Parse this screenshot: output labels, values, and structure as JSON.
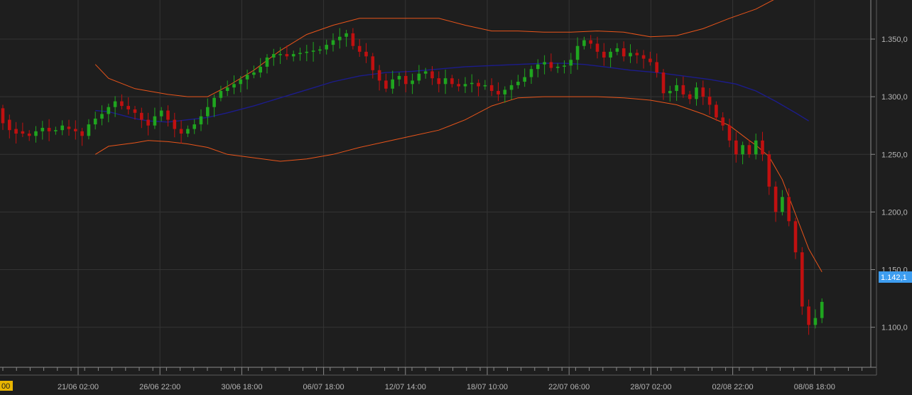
{
  "chart_data": {
    "type": "candlestick",
    "title": "",
    "xlabel": "",
    "ylabel": "",
    "grid": true,
    "y_axis_position": "right",
    "ylim": [
      1060,
      1380
    ],
    "y_ticks": [
      "1.350,0",
      "1.300,0",
      "1.250,0",
      "1.200,0",
      "1.150,0",
      "1.100,0"
    ],
    "y_tick_values": [
      1350,
      1300,
      1250,
      1200,
      1150,
      1100
    ],
    "x_ticks": [
      "21/06 02:00",
      "26/06 22:00",
      "30/06 18:00",
      "06/07 18:00",
      "12/07 14:00",
      "18/07 10:00",
      "22/07 06:00",
      "28/07 02:00",
      "02/08 22:00",
      "08/08 18:00"
    ],
    "x_tick_cut_label": "00",
    "last_price_label": "1.142,1",
    "last_price": 1142.1,
    "colors": {
      "background": "#1e1e1e",
      "grid": "#343434",
      "axis": "#8a8a8a",
      "tick_text": "#b4b4b4",
      "up": "#1fa51f",
      "down": "#c01010",
      "bollinger": "#e8541a",
      "moving_average": "#1c1c8c",
      "price_label_bg": "#3d9df0",
      "price_label_text": "#ffffff",
      "cut_label_bg": "#e9b500"
    },
    "moving_average": [
      [
        14,
        1288
      ],
      [
        16,
        1287
      ],
      [
        18,
        1284
      ],
      [
        20,
        1281
      ],
      [
        22,
        1279
      ],
      [
        25,
        1278
      ],
      [
        28,
        1280
      ],
      [
        31,
        1282
      ],
      [
        34,
        1286
      ],
      [
        38,
        1292
      ],
      [
        42,
        1299
      ],
      [
        46,
        1306
      ],
      [
        50,
        1313
      ],
      [
        54,
        1318
      ],
      [
        58,
        1321
      ],
      [
        62,
        1322
      ],
      [
        66,
        1324
      ],
      [
        70,
        1326
      ],
      [
        74,
        1327
      ],
      [
        78,
        1328
      ],
      [
        82,
        1329
      ],
      [
        85,
        1329
      ],
      [
        88,
        1328
      ],
      [
        91,
        1326
      ],
      [
        95,
        1323
      ],
      [
        99,
        1321
      ],
      [
        103,
        1318
      ],
      [
        107,
        1315
      ],
      [
        111,
        1311
      ],
      [
        114,
        1305
      ],
      [
        117,
        1296
      ],
      [
        120,
        1286
      ],
      [
        122,
        1279
      ]
    ],
    "bollinger_upper": [
      [
        14,
        1328
      ],
      [
        16,
        1316
      ],
      [
        20,
        1307
      ],
      [
        25,
        1302
      ],
      [
        28,
        1300
      ],
      [
        31,
        1300
      ],
      [
        34,
        1309
      ],
      [
        38,
        1323
      ],
      [
        42,
        1340
      ],
      [
        46,
        1354
      ],
      [
        50,
        1362
      ],
      [
        54,
        1368
      ],
      [
        58,
        1368
      ],
      [
        62,
        1368
      ],
      [
        66,
        1368
      ],
      [
        70,
        1362
      ],
      [
        74,
        1357
      ],
      [
        78,
        1357
      ],
      [
        82,
        1356
      ],
      [
        86,
        1356
      ],
      [
        90,
        1357
      ],
      [
        94,
        1356
      ],
      [
        98,
        1352
      ],
      [
        102,
        1353
      ],
      [
        106,
        1359
      ],
      [
        110,
        1368
      ],
      [
        114,
        1376
      ],
      [
        118,
        1388
      ],
      [
        121,
        1400
      ]
    ],
    "bollinger_lower": [
      [
        14,
        1250
      ],
      [
        16,
        1257
      ],
      [
        20,
        1260
      ],
      [
        22,
        1262
      ],
      [
        25,
        1261
      ],
      [
        28,
        1259
      ],
      [
        31,
        1256
      ],
      [
        34,
        1250
      ],
      [
        38,
        1247
      ],
      [
        42,
        1244
      ],
      [
        46,
        1246
      ],
      [
        50,
        1250
      ],
      [
        54,
        1256
      ],
      [
        58,
        1261
      ],
      [
        62,
        1266
      ],
      [
        66,
        1271
      ],
      [
        70,
        1280
      ],
      [
        74,
        1292
      ],
      [
        78,
        1299
      ],
      [
        82,
        1300
      ],
      [
        86,
        1300
      ],
      [
        90,
        1300
      ],
      [
        94,
        1299
      ],
      [
        98,
        1297
      ],
      [
        102,
        1293
      ],
      [
        106,
        1285
      ],
      [
        110,
        1275
      ],
      [
        113,
        1262
      ],
      [
        114,
        1258
      ],
      [
        116,
        1248
      ],
      [
        118,
        1228
      ],
      [
        120,
        1198
      ],
      [
        122,
        1168
      ],
      [
        124,
        1148
      ]
    ],
    "candles": [
      [
        0,
        1290,
        1277
      ],
      [
        1,
        1280,
        1271
      ],
      [
        2,
        1272,
        1268
      ],
      [
        3,
        1270,
        1268
      ],
      [
        4,
        1268,
        1266
      ],
      [
        5,
        1266,
        1270
      ],
      [
        6,
        1270,
        1273
      ],
      [
        7,
        1273,
        1270
      ],
      [
        8,
        1270,
        1271
      ],
      [
        9,
        1271,
        1275
      ],
      [
        10,
        1274,
        1272
      ],
      [
        11,
        1272,
        1270
      ],
      [
        12,
        1270,
        1266
      ],
      [
        13,
        1266,
        1276
      ],
      [
        14,
        1276,
        1281
      ],
      [
        15,
        1281,
        1285
      ],
      [
        16,
        1285,
        1291
      ],
      [
        17,
        1291,
        1296
      ],
      [
        18,
        1296,
        1292
      ],
      [
        19,
        1292,
        1289
      ],
      [
        20,
        1289,
        1286
      ],
      [
        21,
        1286,
        1280
      ],
      [
        22,
        1280,
        1275
      ],
      [
        23,
        1275,
        1283
      ],
      [
        24,
        1283,
        1288
      ],
      [
        25,
        1288,
        1280
      ],
      [
        26,
        1280,
        1272
      ],
      [
        27,
        1272,
        1268
      ],
      [
        28,
        1268,
        1272
      ],
      [
        29,
        1272,
        1276
      ],
      [
        30,
        1276,
        1283
      ],
      [
        31,
        1283,
        1291
      ],
      [
        32,
        1291,
        1299
      ],
      [
        33,
        1299,
        1305
      ],
      [
        34,
        1305,
        1308
      ],
      [
        35,
        1308,
        1311
      ],
      [
        36,
        1311,
        1315
      ],
      [
        37,
        1315,
        1319
      ],
      [
        38,
        1319,
        1321
      ],
      [
        39,
        1321,
        1326
      ],
      [
        40,
        1326,
        1334
      ],
      [
        41,
        1334,
        1337
      ],
      [
        42,
        1337,
        1337
      ],
      [
        43,
        1337,
        1335
      ],
      [
        44,
        1335,
        1337
      ],
      [
        45,
        1337,
        1338
      ],
      [
        46,
        1338,
        1339
      ],
      [
        47,
        1339,
        1340
      ],
      [
        48,
        1340,
        1341
      ],
      [
        49,
        1341,
        1345
      ],
      [
        50,
        1345,
        1349
      ],
      [
        51,
        1349,
        1352
      ],
      [
        52,
        1352,
        1355
      ],
      [
        53,
        1355,
        1344
      ],
      [
        54,
        1344,
        1339
      ],
      [
        55,
        1339,
        1335
      ],
      [
        56,
        1335,
        1323
      ],
      [
        57,
        1323,
        1314
      ],
      [
        58,
        1314,
        1307
      ],
      [
        59,
        1307,
        1315
      ],
      [
        60,
        1315,
        1318
      ],
      [
        61,
        1318,
        1311
      ],
      [
        62,
        1311,
        1314
      ],
      [
        63,
        1314,
        1320
      ],
      [
        64,
        1320,
        1322
      ],
      [
        65,
        1322,
        1316
      ],
      [
        66,
        1316,
        1311
      ],
      [
        67,
        1311,
        1316
      ],
      [
        68,
        1316,
        1311
      ],
      [
        69,
        1311,
        1309
      ],
      [
        70,
        1309,
        1311
      ],
      [
        71,
        1311,
        1312
      ],
      [
        72,
        1312,
        1309
      ],
      [
        73,
        1309,
        1310
      ],
      [
        74,
        1310,
        1305
      ],
      [
        75,
        1305,
        1302
      ],
      [
        76,
        1302,
        1306
      ],
      [
        77,
        1306,
        1310
      ],
      [
        78,
        1310,
        1313
      ],
      [
        79,
        1313,
        1317
      ],
      [
        80,
        1317,
        1324
      ],
      [
        81,
        1324,
        1328
      ],
      [
        82,
        1328,
        1330
      ],
      [
        83,
        1330,
        1325
      ],
      [
        84,
        1325,
        1326
      ],
      [
        85,
        1326,
        1327
      ],
      [
        86,
        1327,
        1332
      ],
      [
        87,
        1332,
        1344
      ],
      [
        88,
        1344,
        1349
      ],
      [
        89,
        1349,
        1346
      ],
      [
        90,
        1346,
        1339
      ],
      [
        91,
        1339,
        1334
      ],
      [
        92,
        1334,
        1339
      ],
      [
        93,
        1339,
        1342
      ],
      [
        94,
        1342,
        1335
      ],
      [
        95,
        1335,
        1338
      ],
      [
        96,
        1338,
        1336
      ],
      [
        97,
        1336,
        1333
      ],
      [
        98,
        1333,
        1330
      ],
      [
        99,
        1330,
        1321
      ],
      [
        100,
        1321,
        1303
      ],
      [
        101,
        1303,
        1305
      ],
      [
        102,
        1305,
        1310
      ],
      [
        103,
        1310,
        1302
      ],
      [
        104,
        1302,
        1298
      ],
      [
        105,
        1298,
        1308
      ],
      [
        106,
        1308,
        1300
      ],
      [
        107,
        1300,
        1293
      ],
      [
        108,
        1293,
        1282
      ],
      [
        109,
        1282,
        1275
      ],
      [
        110,
        1275,
        1262
      ],
      [
        111,
        1262,
        1250
      ],
      [
        112,
        1250,
        1258
      ],
      [
        113,
        1258,
        1250
      ],
      [
        114,
        1250,
        1262
      ],
      [
        115,
        1262,
        1250
      ],
      [
        116,
        1250,
        1222
      ],
      [
        117,
        1222,
        1200
      ],
      [
        118,
        1200,
        1213
      ],
      [
        119,
        1213,
        1192
      ],
      [
        120,
        1192,
        1165
      ],
      [
        121,
        1165,
        1118
      ],
      [
        122,
        1118,
        1102
      ],
      [
        123,
        1102,
        1108
      ],
      [
        124,
        1108,
        1122
      ]
    ]
  }
}
